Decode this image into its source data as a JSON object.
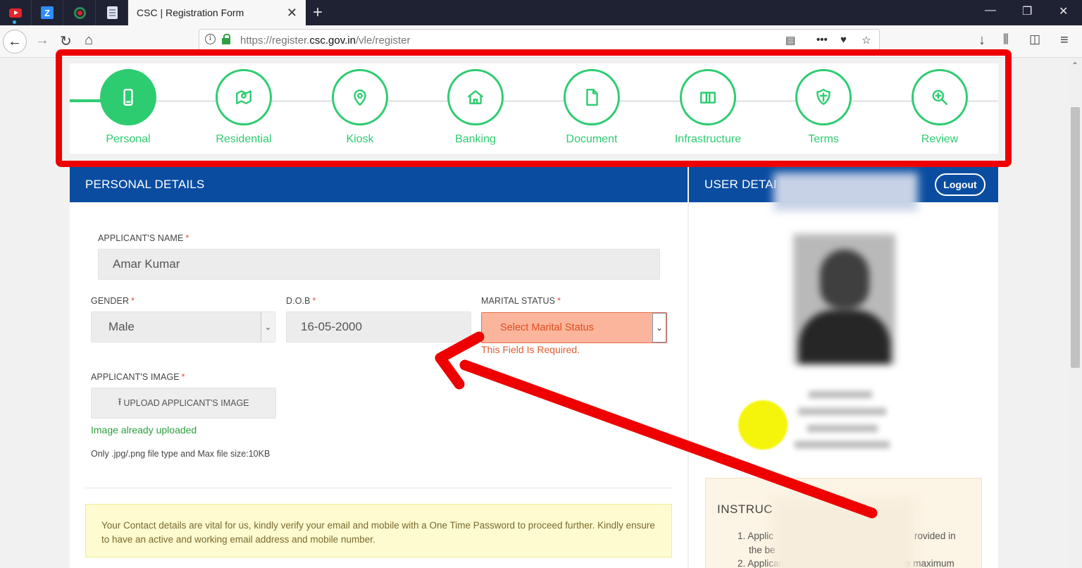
{
  "browser": {
    "pinned_tabs": [
      "youtube-icon",
      "zoom-icon",
      "screen-recorder-icon",
      "document-icon"
    ],
    "active_tab_title": "CSC | Registration Form",
    "url_prefix": "https://register.",
    "url_domain": "csc.gov.in",
    "url_path": "/vle/register"
  },
  "stepper": {
    "steps": [
      {
        "label": "Personal",
        "icon": "mobile-icon",
        "active": true
      },
      {
        "label": "Residential",
        "icon": "map-icon",
        "active": false
      },
      {
        "label": "Kiosk",
        "icon": "location-pin-icon",
        "active": false
      },
      {
        "label": "Banking",
        "icon": "bank-icon",
        "active": false
      },
      {
        "label": "Document",
        "icon": "file-icon",
        "active": false
      },
      {
        "label": "Infrastructure",
        "icon": "book-icon",
        "active": false
      },
      {
        "label": "Terms",
        "icon": "shield-icon",
        "active": false
      },
      {
        "label": "Review",
        "icon": "zoom-in-icon",
        "active": false
      }
    ]
  },
  "personal": {
    "header": "PERSONAL DETAILS",
    "name_label": "APPLICANT'S NAME",
    "name_value": "Amar Kumar",
    "gender_label": "GENDER",
    "gender_value": "Male",
    "dob_label": "D.O.B",
    "dob_value": "16-05-2000",
    "marital_label": "MARITAL STATUS",
    "marital_value": "Select Marital Status",
    "marital_error": "This Field Is Required.",
    "image_label": "APPLICANT'S IMAGE",
    "upload_label": "UPLOAD APPLICANT'S IMAGE",
    "upload_status": "Image already uploaded",
    "upload_hint": "Only .jpg/.png file type and Max file size:10KB",
    "required_mark": "*",
    "notice": "Your Contact details are vital for us, kindly verify your email and mobile with a One Time Password to proceed further. Kindly ensure to have an active and working email address and mobile number."
  },
  "user_details": {
    "header": "USER DETAI",
    "logout_label": "Logout",
    "instructions_title": "INSTRUC",
    "instr_1a": "1. Applic",
    "instr_1b": "rovided in",
    "instr_1c": "the be",
    "instr_2": "2. Applicant's Image should be clear. The maximum"
  },
  "colors": {
    "accent_green": "#2ecc71",
    "header_blue": "#0a4da0",
    "annotation_red": "#ee0000",
    "error_orange": "#fbb59c"
  }
}
